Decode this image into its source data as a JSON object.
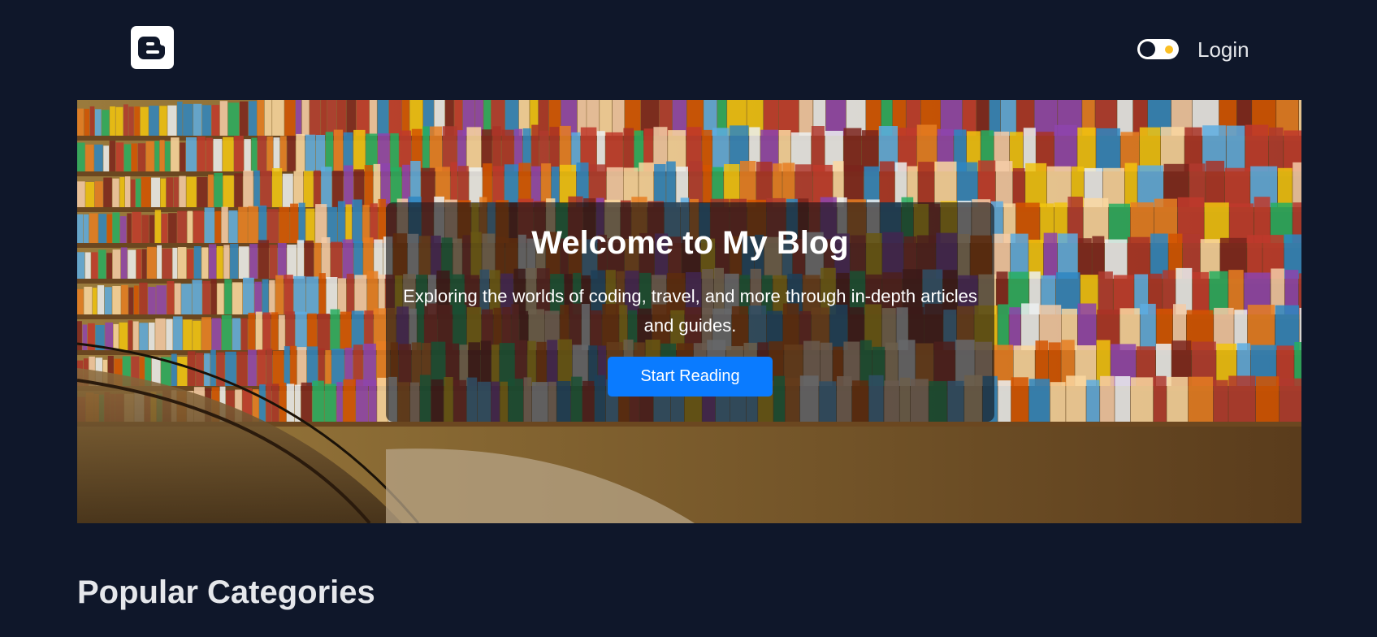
{
  "nav": {
    "logo_icon": "blogger-logo-icon",
    "theme_toggle_icon": "theme-toggle",
    "login_label": "Login"
  },
  "hero": {
    "background_icon": "library-bookshelf-photo",
    "title": "Welcome to My Blog",
    "subtitle": "Exploring the worlds of coding, travel, and more through in-depth articles and guides.",
    "cta_label": "Start Reading"
  },
  "categories": {
    "heading": "Popular Categories"
  },
  "colors": {
    "page_background": "#0f172a",
    "accent": "#0a7bff",
    "toggle_sun": "#fbbf24"
  }
}
